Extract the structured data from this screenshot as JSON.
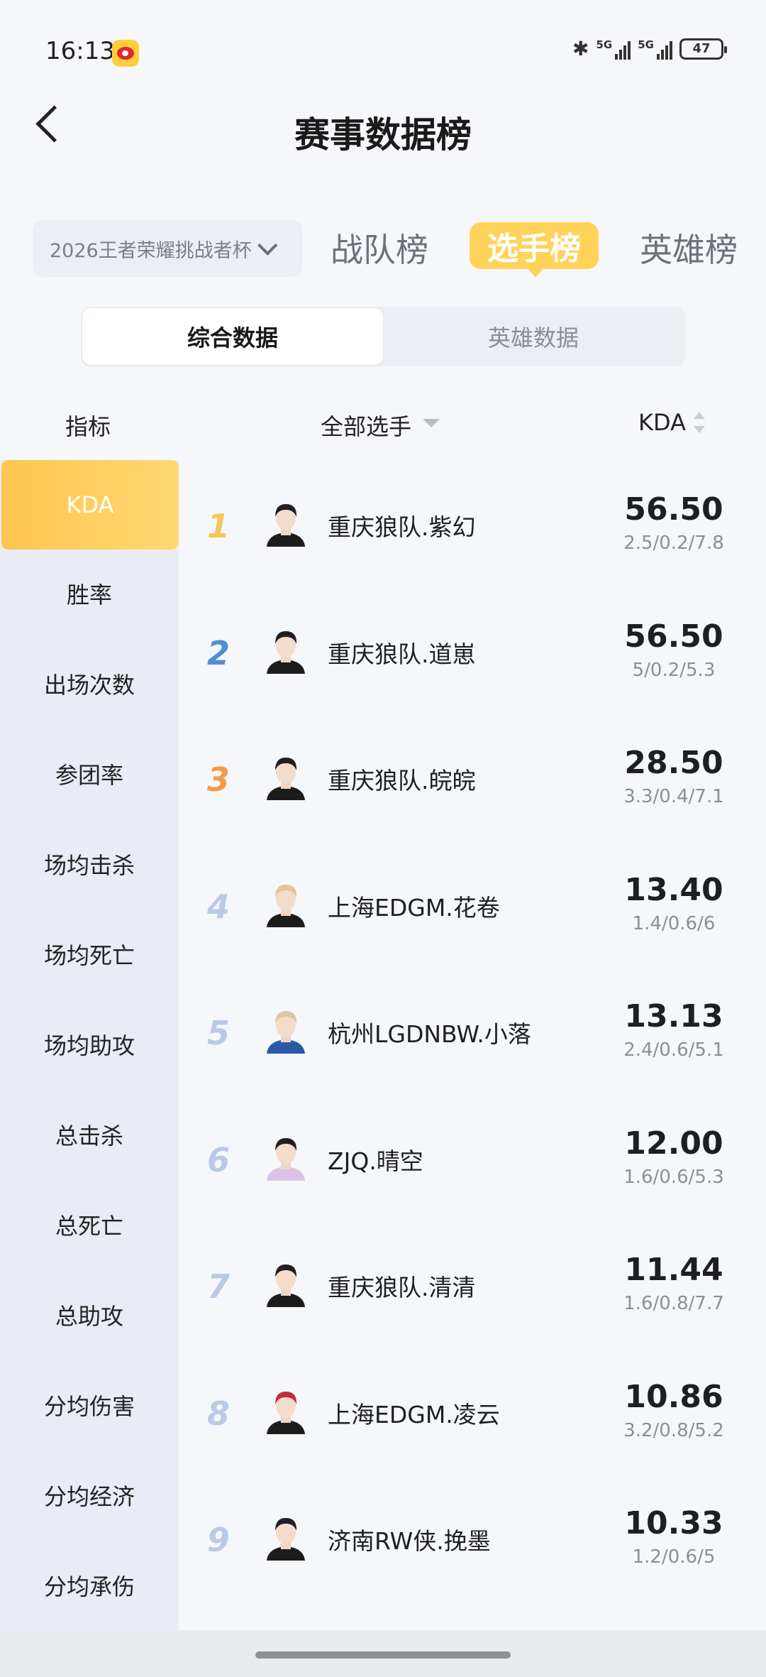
{
  "status": {
    "time": "16:13",
    "net1": "5G",
    "net2": "5G",
    "battery": "47"
  },
  "header": {
    "title": "赛事数据榜"
  },
  "filter": {
    "tournament": "2026王者荣耀挑战者杯"
  },
  "tabs": {
    "team": "战队榜",
    "player": "选手榜",
    "hero": "英雄榜"
  },
  "segments": {
    "overall": "综合数据",
    "hero": "英雄数据"
  },
  "columns": {
    "metric": "指标",
    "players": "全部选手",
    "kda": "KDA"
  },
  "sidebar": {
    "items": [
      "KDA",
      "胜率",
      "出场次数",
      "参团率",
      "场均击杀",
      "场均死亡",
      "场均助攻",
      "总击杀",
      "总死亡",
      "总助攻",
      "分均伤害",
      "分均经济",
      "分均承伤"
    ]
  },
  "ranking": [
    {
      "rank": "1",
      "player": "重庆狼队.紫幻",
      "kda": "56.50",
      "detail": "2.5/0.2/7.8"
    },
    {
      "rank": "2",
      "player": "重庆狼队.道崽",
      "kda": "56.50",
      "detail": "5/0.2/5.3"
    },
    {
      "rank": "3",
      "player": "重庆狼队.皖皖",
      "kda": "28.50",
      "detail": "3.3/0.4/7.1"
    },
    {
      "rank": "4",
      "player": "上海EDGM.花卷",
      "kda": "13.40",
      "detail": "1.4/0.6/6"
    },
    {
      "rank": "5",
      "player": "杭州LGDNBW.小落",
      "kda": "13.13",
      "detail": "2.4/0.6/5.1"
    },
    {
      "rank": "6",
      "player": "ZJQ.晴空",
      "kda": "12.00",
      "detail": "1.6/0.6/5.3"
    },
    {
      "rank": "7",
      "player": "重庆狼队.清清",
      "kda": "11.44",
      "detail": "1.6/0.8/7.7"
    },
    {
      "rank": "8",
      "player": "上海EDGM.凌云",
      "kda": "10.86",
      "detail": "3.2/0.8/5.2"
    },
    {
      "rank": "9",
      "player": "济南RW侠.挽墨",
      "kda": "10.33",
      "detail": "1.2/0.6/5"
    }
  ],
  "colors": {
    "accent": "#ffd35a",
    "rank1": "#f7c55b",
    "rank2": "#4d8fd6",
    "rank3": "#f29a4a",
    "rankOther": "#b9c9e6"
  }
}
